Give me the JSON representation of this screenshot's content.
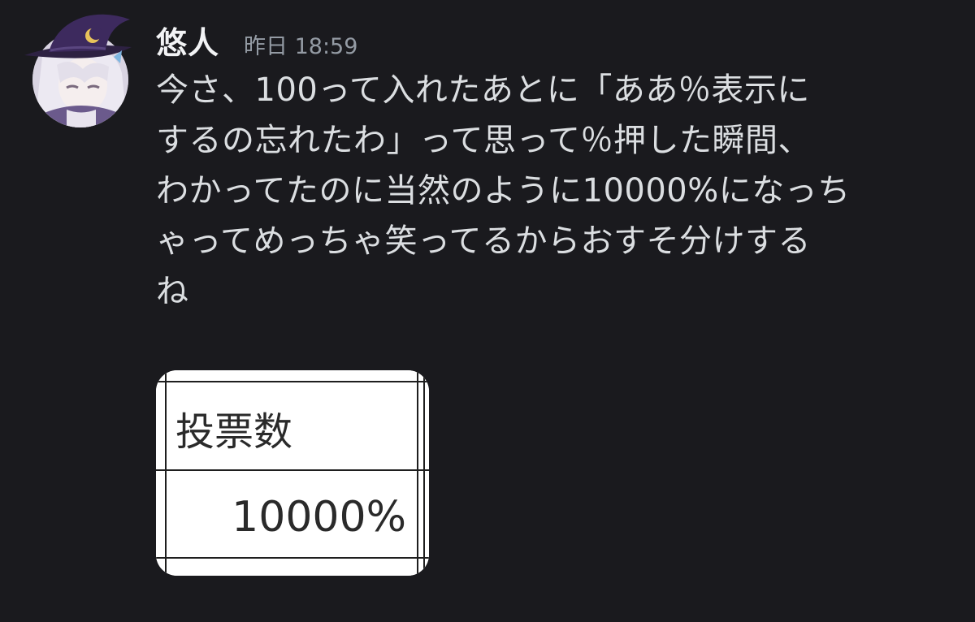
{
  "message": {
    "author": "悠人",
    "timestamp": "昨日 18:59",
    "text_lines": [
      "今さ、100って入れたあとに「ああ％表示に",
      "するの忘れたわ」って思って％押した瞬間、",
      "わかってたのに当然のように10000%になっち",
      "ゃってめっちゃ笑ってるからおすそ分けする",
      "ね"
    ]
  },
  "attachment": {
    "header_cell": "投票数",
    "value_cell": "10000%"
  },
  "avatar": {
    "icon": "witch-hat-avatar-icon",
    "hat_color": "#3d2a5e",
    "moon_color": "#e8c35a",
    "hair_color": "#e6e2ee"
  }
}
